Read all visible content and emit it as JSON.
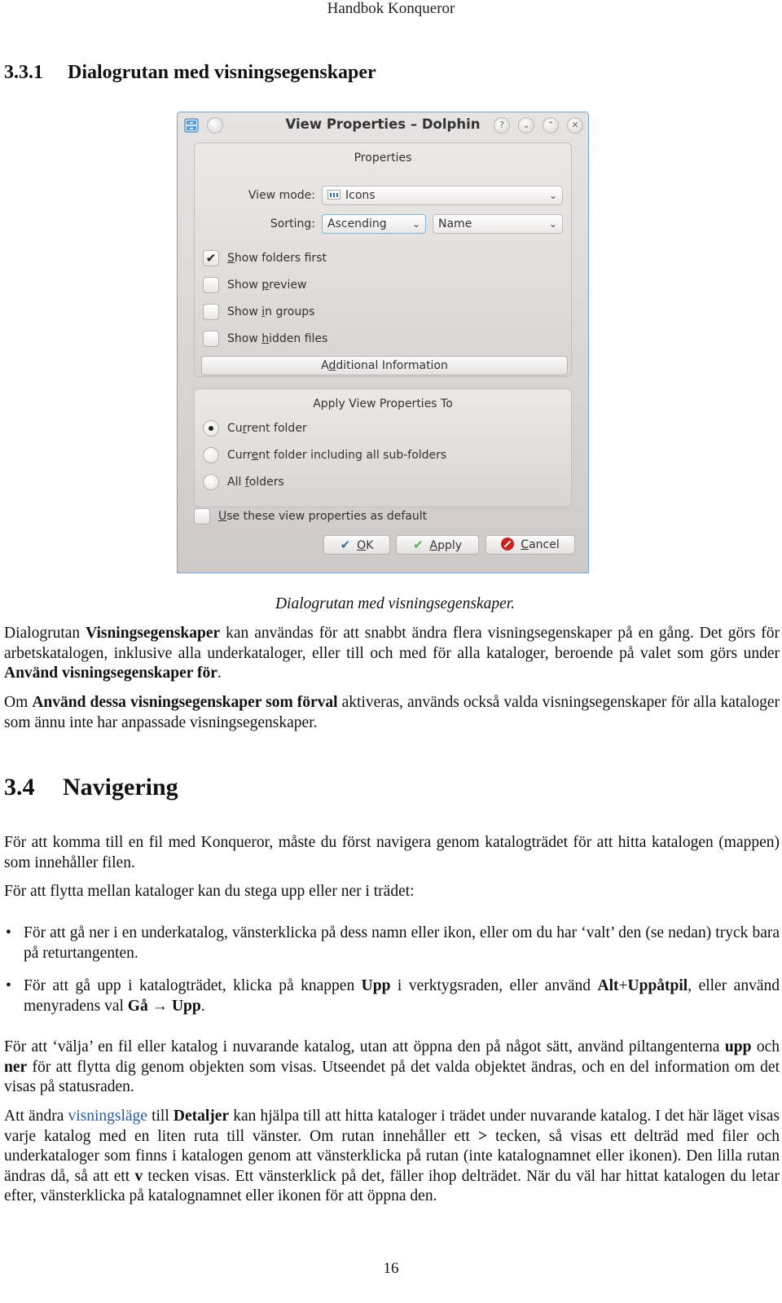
{
  "header": {
    "running_title": "Handbok Konqueror"
  },
  "section_331": {
    "number": "3.3.1",
    "title": "Dialogrutan med visningsegenskaper"
  },
  "dialog": {
    "title": "View Properties – Dolphin",
    "titlebar_buttons": {
      "help": "?",
      "minimize": "⌄",
      "maximize": "⌃",
      "close": "✕"
    },
    "properties_group": {
      "title": "Properties",
      "view_mode_label": "View mode:",
      "view_mode_value": "Icons",
      "sorting_label": "Sorting:",
      "sorting_order_value": "Ascending",
      "sorting_field_value": "Name",
      "checkboxes": [
        {
          "pre": "",
          "mnemonic": "S",
          "post": "how folders first",
          "checked": true
        },
        {
          "pre": "Show ",
          "mnemonic": "p",
          "post": "review",
          "checked": false
        },
        {
          "pre": "Show ",
          "mnemonic": "i",
          "post": "n groups",
          "checked": false
        },
        {
          "pre": "Show ",
          "mnemonic": "h",
          "post": "idden files",
          "checked": false
        }
      ],
      "additional_info_button": {
        "pre": "A",
        "mnemonic": "d",
        "post": "ditional Information"
      }
    },
    "apply_group": {
      "title": "Apply View Properties To",
      "radios": [
        {
          "pre": "Cu",
          "mnemonic": "r",
          "post": "rent folder",
          "selected": true
        },
        {
          "pre": "Curr",
          "mnemonic": "e",
          "post": "nt folder including all sub-folders",
          "selected": false
        },
        {
          "pre": "All ",
          "mnemonic": "f",
          "post": "olders",
          "selected": false
        }
      ]
    },
    "default_checkbox": {
      "pre": "",
      "mnemonic": "U",
      "post": "se these view properties as default",
      "checked": false
    },
    "buttons": {
      "ok": {
        "mnemonic": "O",
        "post": "K"
      },
      "apply": {
        "mnemonic": "A",
        "post": "pply"
      },
      "cancel": {
        "mnemonic": "C",
        "post": "ancel"
      }
    }
  },
  "figure_caption": "Dialogrutan med visningsegenskaper.",
  "paragraphs_331": [
    {
      "segments": [
        {
          "t": "Dialogrutan "
        },
        {
          "t": "Visningsegenskaper",
          "b": true
        },
        {
          "t": " kan användas för att snabbt ändra flera visningsegenskaper på en gång. Det görs för arbetskatalogen, inklusive alla underkataloger, eller till och med för alla kataloger, beroende på valet som görs under "
        },
        {
          "t": "Använd visningsegenskaper för",
          "b": true
        },
        {
          "t": "."
        }
      ]
    },
    {
      "segments": [
        {
          "t": "Om "
        },
        {
          "t": "Använd dessa visningsegenskaper som förval",
          "b": true
        },
        {
          "t": " aktiveras, används också valda visningsegenskaper för alla kataloger som ännu inte har anpassade visningsegenskaper."
        }
      ]
    }
  ],
  "section_34": {
    "number": "3.4",
    "title": "Navigering"
  },
  "paragraphs_34": [
    {
      "segments": [
        {
          "t": "För att komma till en fil med Konqueror, måste du först navigera genom katalogträdet för att hitta katalogen (mappen) som innehåller filen."
        }
      ]
    },
    {
      "segments": [
        {
          "t": "För att flytta mellan kataloger kan du stega upp eller ner i trädet:"
        }
      ]
    }
  ],
  "bullets": [
    {
      "segments": [
        {
          "t": "För att gå ner i en underkatalog, vänsterklicka på dess namn eller ikon, eller om du har ‘valt’ den (se nedan) tryck bara på returtangenten."
        }
      ]
    },
    {
      "segments": [
        {
          "t": "För att gå upp i katalogträdet, klicka på knappen "
        },
        {
          "t": "Upp",
          "b": true
        },
        {
          "t": " i verktygsraden, eller använd "
        },
        {
          "t": "Alt",
          "b": true
        },
        {
          "t": "+"
        },
        {
          "t": "Uppåtpil",
          "b": true
        },
        {
          "t": ", eller använd menyradens val "
        },
        {
          "t": "Gå",
          "b": true
        },
        {
          "t": " → "
        },
        {
          "t": "Upp",
          "b": true
        },
        {
          "t": "."
        }
      ]
    }
  ],
  "paragraphs_after": [
    {
      "segments": [
        {
          "t": "För att ‘välja’ en fil eller katalog i nuvarande katalog, utan att öppna den på något sätt, använd piltangenterna "
        },
        {
          "t": "upp",
          "b": true
        },
        {
          "t": " och "
        },
        {
          "t": "ner",
          "b": true
        },
        {
          "t": " för att flytta dig genom objekten som visas. Utseendet på det valda objektet ändras, och en del information om det visas på statusraden."
        }
      ]
    },
    {
      "segments": [
        {
          "t": "Att ändra "
        },
        {
          "t": "visningsläge",
          "link": true
        },
        {
          "t": " till "
        },
        {
          "t": "Detaljer",
          "b": true
        },
        {
          "t": " kan hjälpa till att hitta kataloger i trädet under nuvarande katalog. I det här läget visas varje katalog med en liten ruta till vänster. Om rutan innehåller ett "
        },
        {
          "t": ">",
          "b": true
        },
        {
          "t": " tecken, så visas ett delträd med filer och underkataloger som finns i katalogen genom att vänsterklicka på rutan (inte katalognamnet eller ikonen). Den lilla rutan ändras då, så att ett "
        },
        {
          "t": "v",
          "b": true
        },
        {
          "t": " tecken visas. Ett vänsterklick på det, fäller ihop delträdet. När du väl har hittat katalogen du letar efter, vänsterklicka på katalognamnet eller ikonen för att öppna den."
        }
      ]
    }
  ],
  "page_number": "16"
}
